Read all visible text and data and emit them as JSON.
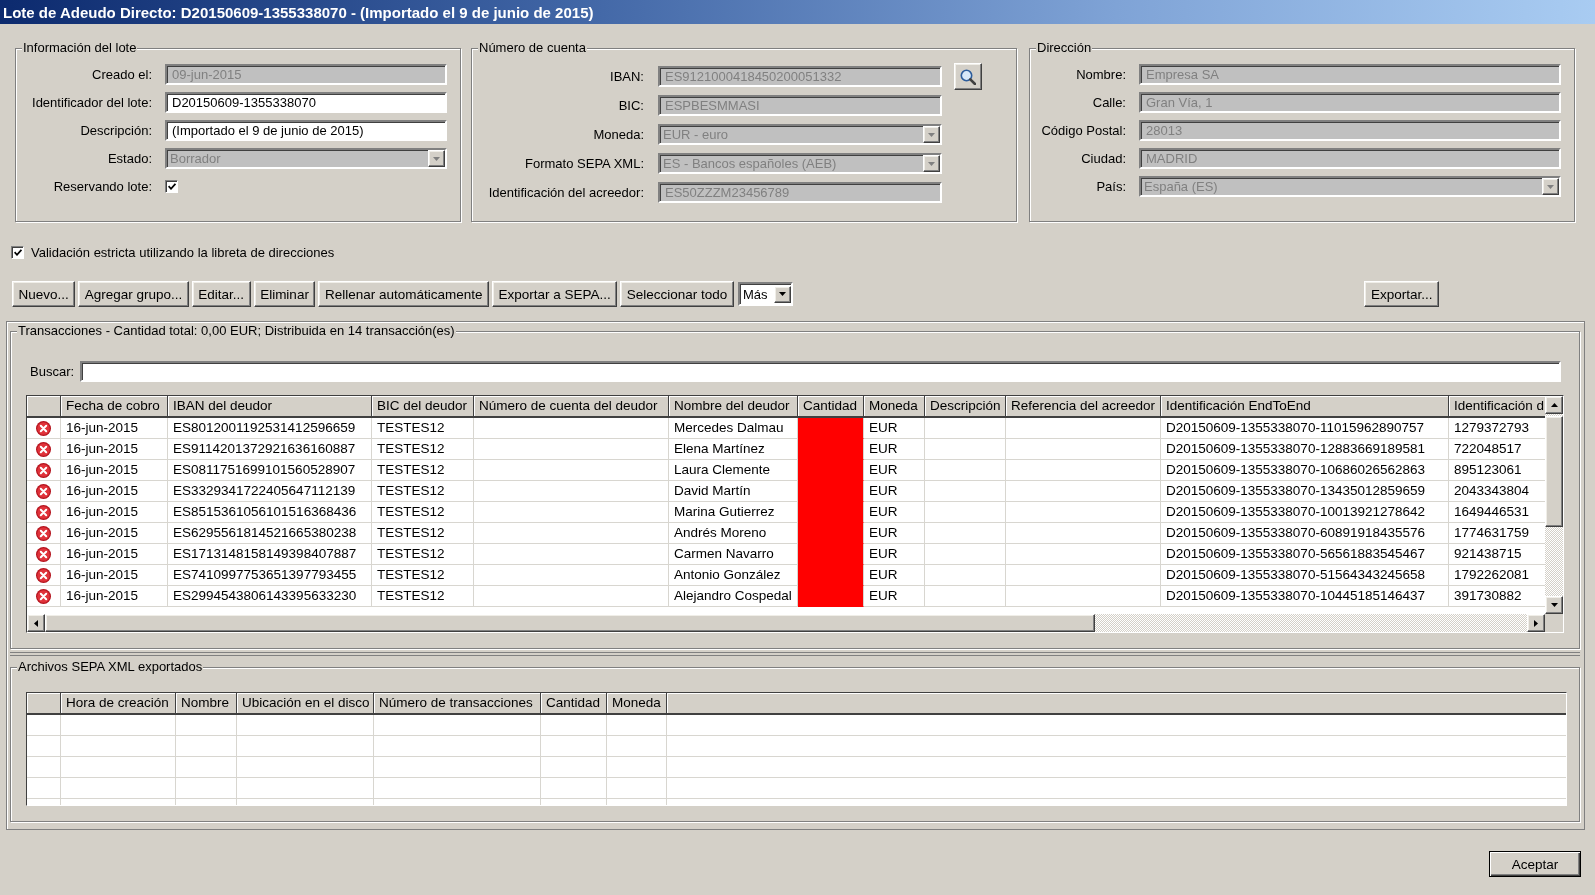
{
  "window": {
    "title": "Lote de Adeudo Directo: D20150609-1355338070 - (Importado el 9 de junio de 2015)"
  },
  "batch_info": {
    "legend": "Información del lote",
    "fields": [
      {
        "kind": "text",
        "label": "Creado el:",
        "value": "09-jun-2015",
        "disabled": true
      },
      {
        "kind": "text",
        "label": "Identificador del lote:",
        "value": "D20150609-1355338070",
        "disabled": false
      },
      {
        "kind": "text",
        "label": "Descripción:",
        "value": "(Importado el 9 de junio de 2015)",
        "disabled": false
      },
      {
        "kind": "combo",
        "label": "Estado:",
        "value": "Borrador",
        "disabled": true
      },
      {
        "kind": "checkbox",
        "label": "Reservando lote:",
        "checked": true
      }
    ]
  },
  "account": {
    "legend": "Número de cuenta",
    "fields": [
      {
        "kind": "lookup",
        "label": "IBAN:",
        "value": "ES9121000418450200051332",
        "disabled": true
      },
      {
        "kind": "text",
        "label": "BIC:",
        "value": "ESPBESMMASI",
        "disabled": true
      },
      {
        "kind": "combo",
        "label": "Moneda:",
        "value": "EUR - euro",
        "disabled": true
      },
      {
        "kind": "combo",
        "label": "Formato SEPA XML:",
        "value": "ES - Bancos españoles (AEB)",
        "disabled": true
      },
      {
        "kind": "text",
        "label": "Identificación del acreedor:",
        "value": "ES50ZZZM23456789",
        "disabled": true
      }
    ]
  },
  "address": {
    "legend": "Dirección",
    "fields": [
      {
        "kind": "text",
        "label": "Nombre:",
        "value": "Empresa SA",
        "disabled": true
      },
      {
        "kind": "text",
        "label": "Calle:",
        "value": "Gran Vía, 1",
        "disabled": true
      },
      {
        "kind": "text",
        "label": "Código Postal:",
        "value": "28013",
        "disabled": true
      },
      {
        "kind": "text",
        "label": "Ciudad:",
        "value": "MADRID",
        "disabled": true
      },
      {
        "kind": "combo",
        "label": "País:",
        "value": "España (ES)",
        "disabled": true
      }
    ]
  },
  "strict_validation": {
    "label": "Validación estricta utilizando la libreta de direcciones",
    "checked": true
  },
  "toolbar": {
    "buttons": [
      {
        "kind": "button",
        "label": "Nuevo..."
      },
      {
        "kind": "button",
        "label": "Agregar grupo..."
      },
      {
        "kind": "button",
        "label": "Editar..."
      },
      {
        "kind": "button",
        "label": "Eliminar"
      },
      {
        "kind": "button",
        "label": "Rellenar automáticamente"
      },
      {
        "kind": "button",
        "label": "Exportar a SEPA..."
      },
      {
        "kind": "button",
        "label": "Seleccionar todo"
      },
      {
        "kind": "combo",
        "label": "Más"
      }
    ],
    "right_buttons": [
      {
        "kind": "button",
        "label": "Exportar..."
      }
    ]
  },
  "transactions": {
    "legend": "Transacciones - Cantidad total: 0,00 EUR; Distribuida en 14 transacción(es)",
    "search": {
      "label": "Buscar:"
    },
    "table": {
      "columns": [
        "Fecha de cobro",
        "IBAN del deudor",
        "BIC del deudor",
        "Número de cuenta del deudor",
        "Nombre del deudor",
        "Cantidad",
        "Moneda",
        "Descripción",
        "Referencia del acreedor",
        "Identificación EndToEnd",
        "Identificación d"
      ],
      "rows": [
        {
          "error": true,
          "amount_invalid": true,
          "collection_date": "16-jun-2015",
          "debtor_iban": "ES8012001192531412596659",
          "debtor_bic": "TESTES12",
          "debtor_name": "Mercedes Dalmau",
          "currency": "EUR",
          "end_to_end_id": "D20150609-1355338070-11015962890757",
          "column_11": "1279372793"
        },
        {
          "error": true,
          "amount_invalid": true,
          "collection_date": "16-jun-2015",
          "debtor_iban": "ES9114201372921636160887",
          "debtor_bic": "TESTES12",
          "debtor_name": "Elena Martínez",
          "currency": "EUR",
          "end_to_end_id": "D20150609-1355338070-12883669189581",
          "column_11": "722048517"
        },
        {
          "error": true,
          "amount_invalid": true,
          "collection_date": "16-jun-2015",
          "debtor_iban": "ES0811751699101560528907",
          "debtor_bic": "TESTES12",
          "debtor_name": "Laura Clemente",
          "currency": "EUR",
          "end_to_end_id": "D20150609-1355338070-10686026562863",
          "column_11": "895123061"
        },
        {
          "error": true,
          "amount_invalid": true,
          "collection_date": "16-jun-2015",
          "debtor_iban": "ES3329341722405647112139",
          "debtor_bic": "TESTES12",
          "debtor_name": "David Martín",
          "currency": "EUR",
          "end_to_end_id": "D20150609-1355338070-13435012859659",
          "column_11": "2043343804"
        },
        {
          "error": true,
          "amount_invalid": true,
          "collection_date": "16-jun-2015",
          "debtor_iban": "ES8515361056101516368436",
          "debtor_bic": "TESTES12",
          "debtor_name": "Marina Gutierrez",
          "currency": "EUR",
          "end_to_end_id": "D20150609-1355338070-10013921278642",
          "column_11": "1649446531"
        },
        {
          "error": true,
          "amount_invalid": true,
          "collection_date": "16-jun-2015",
          "debtor_iban": "ES6295561814521665380238",
          "debtor_bic": "TESTES12",
          "debtor_name": "Andrés Moreno",
          "currency": "EUR",
          "end_to_end_id": "D20150609-1355338070-60891918435576",
          "column_11": "1774631759"
        },
        {
          "error": true,
          "amount_invalid": true,
          "collection_date": "16-jun-2015",
          "debtor_iban": "ES1713148158149398407887",
          "debtor_bic": "TESTES12",
          "debtor_name": "Carmen Navarro",
          "currency": "EUR",
          "end_to_end_id": "D20150609-1355338070-56561883545467",
          "column_11": "921438715"
        },
        {
          "error": true,
          "amount_invalid": true,
          "collection_date": "16-jun-2015",
          "debtor_iban": "ES7410997753651397793455",
          "debtor_bic": "TESTES12",
          "debtor_name": "Antonio González",
          "currency": "EUR",
          "end_to_end_id": "D20150609-1355338070-51564343245658",
          "column_11": "1792262081"
        },
        {
          "error": true,
          "amount_invalid": true,
          "collection_date": "16-jun-2015",
          "debtor_iban": "ES2994543806143395633230",
          "debtor_bic": "TESTES12",
          "debtor_name": "Alejandro Cospedal",
          "currency": "EUR",
          "end_to_end_id": "D20150609-1355338070-10445185146437",
          "column_11": "391730882"
        }
      ]
    }
  },
  "exported_files": {
    "legend": "Archivos SEPA XML exportados",
    "table": {
      "columns": [
        "Hora de creación",
        "Nombre",
        "Ubicación en el disco",
        "Número de transacciones",
        "Cantidad",
        "Moneda"
      ]
    }
  },
  "buttons": [
    {
      "label": "Aceptar",
      "default": true
    }
  ]
}
